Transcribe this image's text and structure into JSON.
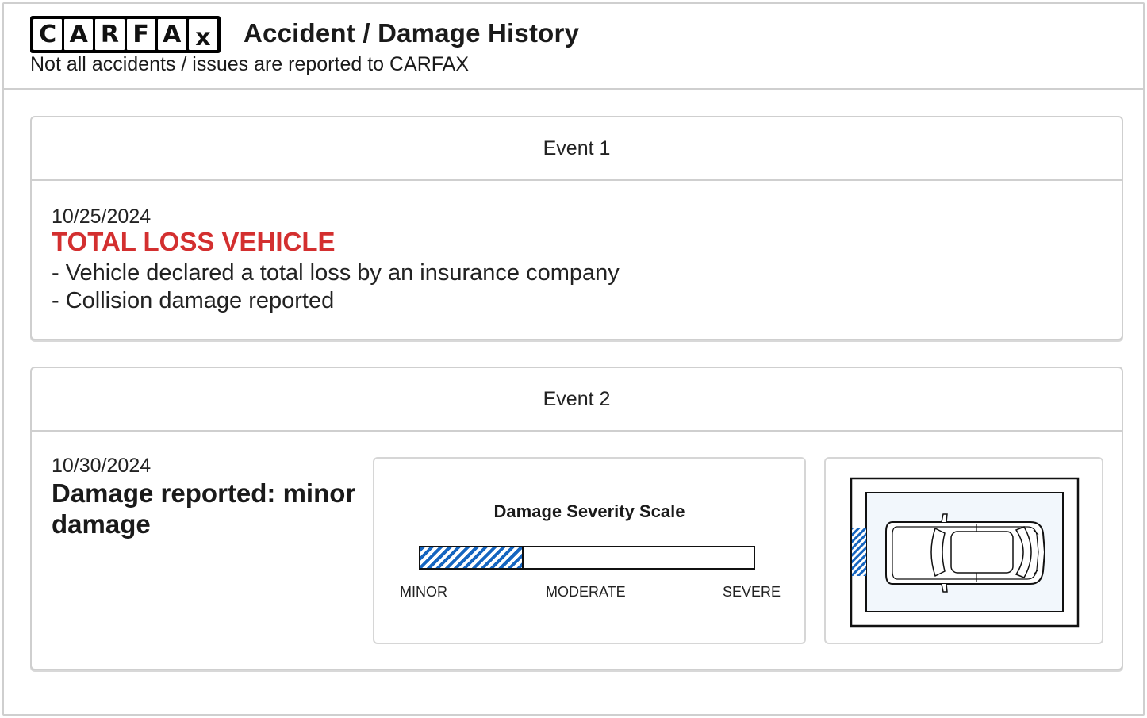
{
  "header": {
    "logo_letters": [
      "C",
      "A",
      "R",
      "F",
      "A",
      "x"
    ],
    "title": "Accident / Damage History",
    "subtitle": "Not all accidents / issues are reported to CARFAX"
  },
  "events": [
    {
      "label": "Event 1",
      "date": "10/25/2024",
      "headline": "TOTAL LOSS VEHICLE",
      "details": [
        "- Vehicle declared a total loss by an insurance company",
        "- Collision damage reported"
      ]
    },
    {
      "label": "Event 2",
      "date": "10/30/2024",
      "headline": "Damage reported: minor damage",
      "severity_scale": {
        "title": "Damage Severity Scale",
        "labels": [
          "MINOR",
          "MODERATE",
          "SEVERE"
        ],
        "level_fraction": 0.31,
        "level": "MINOR"
      },
      "damage_location": "rear"
    }
  ],
  "colors": {
    "alert_red": "#d32f2f",
    "damage_blue": "#1565c0",
    "border_gray": "#cfcfcf"
  }
}
